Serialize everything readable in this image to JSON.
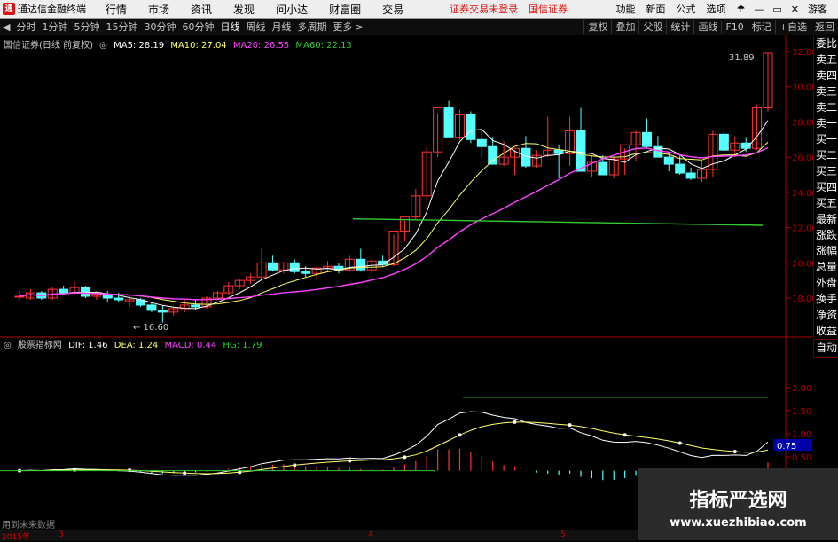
{
  "menubar": {
    "app_title": "通达信金融终端",
    "items": [
      "行情",
      "市场",
      "资讯",
      "发现",
      "问小达",
      "财富圈",
      "交易"
    ],
    "alert": "证券交易未登录",
    "broker": "国信证券",
    "right_items": [
      "功能",
      "新面",
      "公式",
      "选项"
    ],
    "login": "游客"
  },
  "toolbar": {
    "periods": [
      "分时",
      "1分钟",
      "5分钟",
      "15分钟",
      "30分钟",
      "60分钟",
      "日线",
      "周线",
      "月线",
      "多周期",
      "更多 >"
    ],
    "active_period": "日线",
    "right_items": [
      "复权",
      "叠加",
      "父股",
      "统计",
      "画线",
      "F10",
      "标记",
      "+自选",
      "返回"
    ]
  },
  "main_chart": {
    "title": "国信证券(日线 前复权)",
    "ma_labels": [
      {
        "text": "MA5: 28.19",
        "color": "#ffffff"
      },
      {
        "text": "MA10: 27.04",
        "color": "#ffff66"
      },
      {
        "text": "MA20: 26.55",
        "color": "#ff44ff"
      },
      {
        "text": "MA60: 22.13",
        "color": "#33cc33"
      }
    ],
    "price_ticks": [
      "32.00",
      "30.00",
      "28.00",
      "26.00",
      "24.00",
      "22.00",
      "20.00",
      "18.00"
    ],
    "high_label": "31.89",
    "low_label": "16.60"
  },
  "sub_chart": {
    "title": "股票指标网",
    "labels": [
      {
        "text": "DIF: 1.46",
        "color": "#ffffff"
      },
      {
        "text": "DEA: 1.24",
        "color": "#ffff66"
      },
      {
        "text": "MACD: 0.44",
        "color": "#ff44ff"
      },
      {
        "text": "HG: 1.79",
        "color": "#33cc33"
      }
    ],
    "ticks": [
      "2.00",
      "1.50",
      "1.00",
      "0.50"
    ],
    "highlight_value": "0.75"
  },
  "side_panel": {
    "items": [
      "委比",
      "卖五",
      "卖四",
      "卖三",
      "卖二",
      "卖一",
      "买一",
      "买二",
      "买三",
      "买四",
      "买五",
      "最新",
      "涨跌",
      "涨幅",
      "总量",
      "外盘",
      "换手",
      "净资",
      "收益"
    ],
    "auto": "自动"
  },
  "bottom_note": "用到未来数据",
  "date_labels": [
    "2015年",
    "3",
    "4",
    "5"
  ],
  "watermark": {
    "title": "指标严选网",
    "url": "www.xuezhibiao.com"
  },
  "colors": {
    "up": "#ff3333",
    "down": "#54ffff",
    "ma5": "#ffffff",
    "ma10": "#ffff66",
    "ma20": "#ff44ff",
    "ma60": "#33cc33",
    "axis": "#aa0000"
  },
  "chart_data": {
    "type": "candlestick",
    "period": "daily",
    "ylim": [
      17.0,
      32.5
    ],
    "candles": [
      [
        18.1,
        18.4,
        17.9,
        18.1
      ],
      [
        18.0,
        18.5,
        17.9,
        18.3
      ],
      [
        18.3,
        18.4,
        17.9,
        18.0
      ],
      [
        18.0,
        18.6,
        17.9,
        18.5
      ],
      [
        18.5,
        18.7,
        18.2,
        18.3
      ],
      [
        18.3,
        18.9,
        18.2,
        18.6
      ],
      [
        18.6,
        18.7,
        18.0,
        18.1
      ],
      [
        18.1,
        18.3,
        17.9,
        18.2
      ],
      [
        18.2,
        18.4,
        17.8,
        18.0
      ],
      [
        18.0,
        18.3,
        17.8,
        17.9
      ],
      [
        17.8,
        18.1,
        17.5,
        17.9
      ],
      [
        17.9,
        18.0,
        17.5,
        17.6
      ],
      [
        17.6,
        17.8,
        17.2,
        17.3
      ],
      [
        17.3,
        17.6,
        16.6,
        17.2
      ],
      [
        17.2,
        17.5,
        17.0,
        17.4
      ],
      [
        17.4,
        17.9,
        17.2,
        17.6
      ],
      [
        17.6,
        17.9,
        17.3,
        17.5
      ],
      [
        17.5,
        18.1,
        17.4,
        18.0
      ],
      [
        18.0,
        18.4,
        17.9,
        18.3
      ],
      [
        18.3,
        18.9,
        18.2,
        18.7
      ],
      [
        18.7,
        19.1,
        18.5,
        19.0
      ],
      [
        19.0,
        19.4,
        18.8,
        19.2
      ],
      [
        19.2,
        20.8,
        19.1,
        20.0
      ],
      [
        20.0,
        20.4,
        19.5,
        19.6
      ],
      [
        19.6,
        20.0,
        19.4,
        20.0
      ],
      [
        20.0,
        20.2,
        19.4,
        19.5
      ],
      [
        19.5,
        19.8,
        19.2,
        19.4
      ],
      [
        19.4,
        19.8,
        19.1,
        19.7
      ],
      [
        19.7,
        20.1,
        19.5,
        19.8
      ],
      [
        19.8,
        20.0,
        19.4,
        19.6
      ],
      [
        19.6,
        20.4,
        19.5,
        20.2
      ],
      [
        20.2,
        20.8,
        19.5,
        19.6
      ],
      [
        19.6,
        20.2,
        19.4,
        20.1
      ],
      [
        20.1,
        20.4,
        19.8,
        19.9
      ],
      [
        19.9,
        21.6,
        19.8,
        21.8
      ],
      [
        21.8,
        22.4,
        21.2,
        22.6
      ],
      [
        22.6,
        24.2,
        22.4,
        23.8
      ],
      [
        23.8,
        26.6,
        23.5,
        26.3
      ],
      [
        26.3,
        28.5,
        26.0,
        28.8
      ],
      [
        28.8,
        29.2,
        27.5,
        27.1
      ],
      [
        27.1,
        28.7,
        27.0,
        28.4
      ],
      [
        28.4,
        28.6,
        26.8,
        27.0
      ],
      [
        27.0,
        27.5,
        26.0,
        26.6
      ],
      [
        26.6,
        27.1,
        25.6,
        25.6
      ],
      [
        25.6,
        26.9,
        25.5,
        26.0
      ],
      [
        26.0,
        26.4,
        25.0,
        26.5
      ],
      [
        26.5,
        27.2,
        25.4,
        25.5
      ],
      [
        25.5,
        26.4,
        25.4,
        26.1
      ],
      [
        26.1,
        28.3,
        26.0,
        26.4
      ],
      [
        26.4,
        26.7,
        24.8,
        26.2
      ],
      [
        26.2,
        28.3,
        25.5,
        27.5
      ],
      [
        27.5,
        28.8,
        25.3,
        25.2
      ],
      [
        25.2,
        26.1,
        24.9,
        25.7
      ],
      [
        25.7,
        26.1,
        25.0,
        25.0
      ],
      [
        25.0,
        26.0,
        24.8,
        25.9
      ],
      [
        25.9,
        26.5,
        25.0,
        26.7
      ],
      [
        26.7,
        27.5,
        25.8,
        27.4
      ],
      [
        27.4,
        28.2,
        26.5,
        26.6
      ],
      [
        26.6,
        27.2,
        26.0,
        26.0
      ],
      [
        26.0,
        26.3,
        25.2,
        25.6
      ],
      [
        25.6,
        26.1,
        25.0,
        25.1
      ],
      [
        25.1,
        25.4,
        24.7,
        24.8
      ],
      [
        24.8,
        25.8,
        24.6,
        25.3
      ],
      [
        25.3,
        27.5,
        24.9,
        27.3
      ],
      [
        27.3,
        27.6,
        26.3,
        26.4
      ],
      [
        26.4,
        27.2,
        26.0,
        26.8
      ],
      [
        26.8,
        27.1,
        26.3,
        26.5
      ],
      [
        26.5,
        29.0,
        26.4,
        28.8
      ],
      [
        28.8,
        31.9,
        28.6,
        31.9
      ]
    ],
    "ma60": [
      [
        398,
        22.5
      ],
      [
        860,
        22.13
      ]
    ],
    "macd_scale": [
      -0.5,
      2.5
    ],
    "hg_level": 1.79
  }
}
